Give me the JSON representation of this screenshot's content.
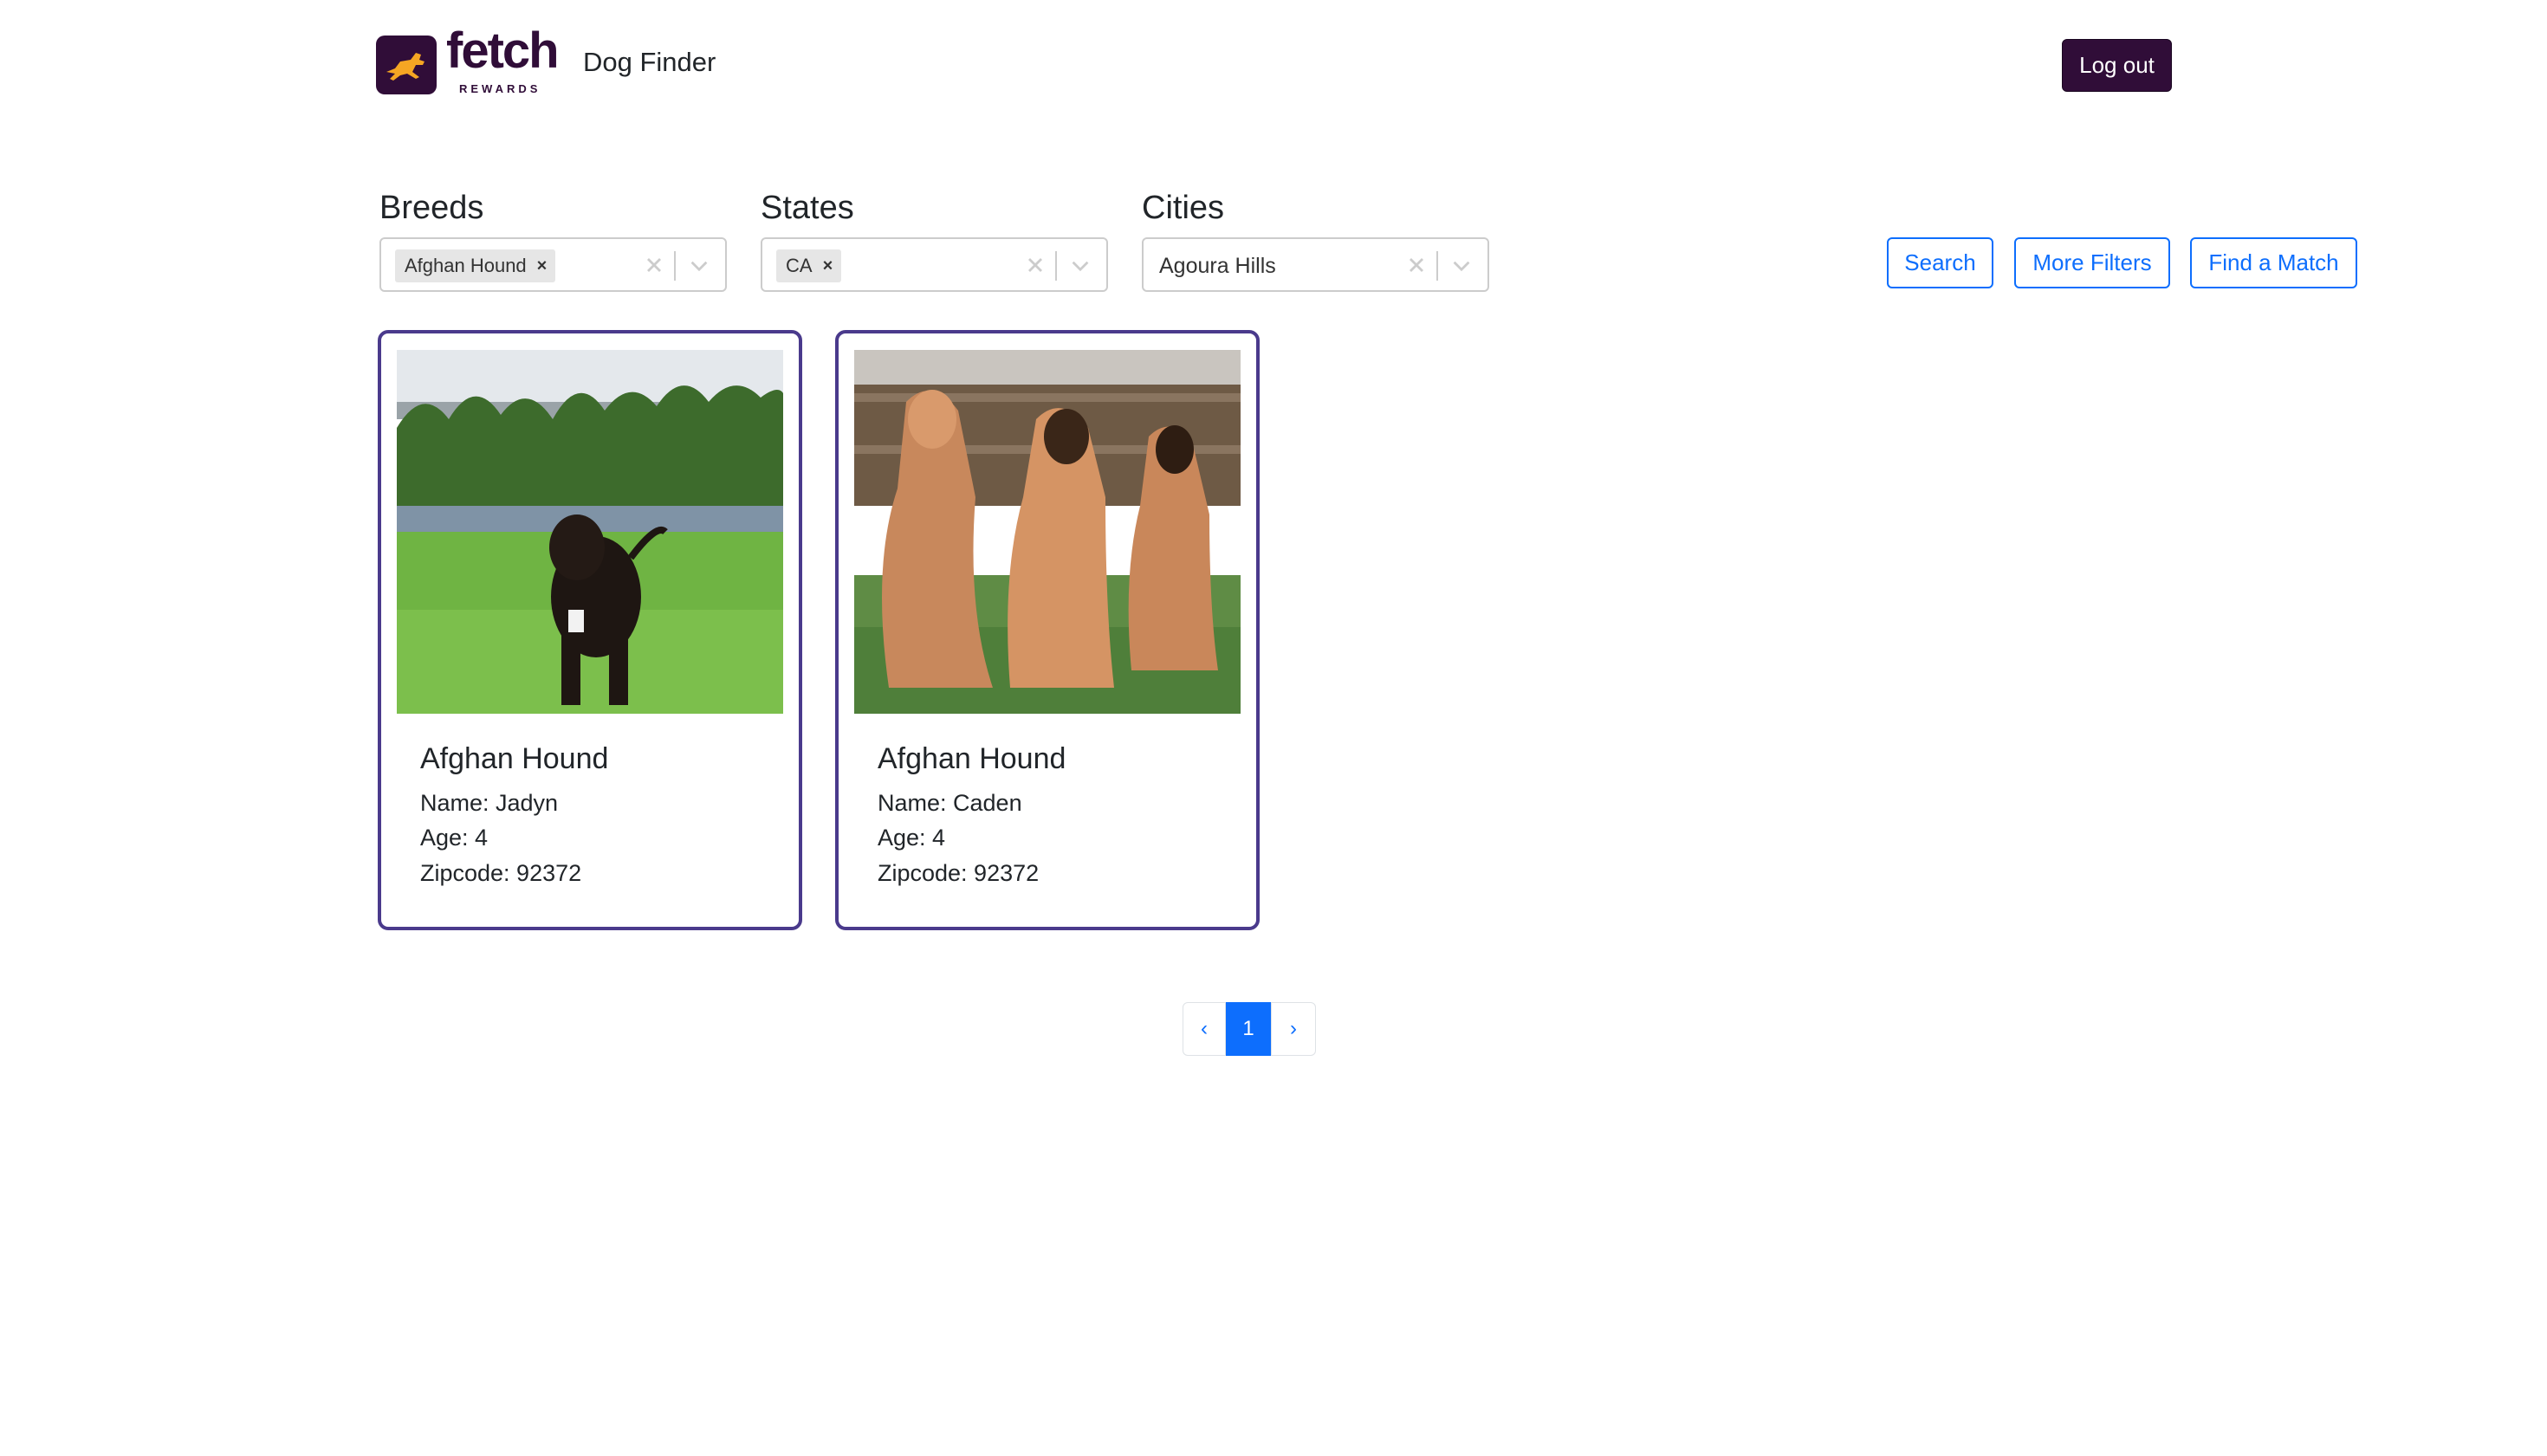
{
  "header": {
    "logo_word": "fetch",
    "logo_sub": "REWARDS",
    "app_title": "Dog Finder",
    "logout_label": "Log out"
  },
  "filters": {
    "breeds": {
      "label": "Breeds",
      "selected_chips": [
        "Afghan Hound"
      ]
    },
    "states": {
      "label": "States",
      "selected_chips": [
        "CA"
      ]
    },
    "cities": {
      "label": "Cities",
      "value": "Agoura Hills"
    }
  },
  "actions": {
    "search_label": "Search",
    "more_filters_label": "More Filters",
    "find_match_label": "Find a Match"
  },
  "dogs": [
    {
      "breed": "Afghan Hound",
      "name": "Name: Jadyn",
      "age": "Age: 4",
      "zipcode": "Zipcode: 92372"
    },
    {
      "breed": "Afghan Hound",
      "name": "Name: Caden",
      "age": "Age: 4",
      "zipcode": "Zipcode: 92372"
    }
  ],
  "pagination": {
    "prev": "‹",
    "current": "1",
    "next": "›"
  },
  "colors": {
    "brand": "#300d38",
    "accent": "#0d6efd",
    "card_border": "#4a3a8c",
    "logo_dog": "#f5a623"
  },
  "icons": {
    "logo": "running-dog-icon",
    "chip_remove": "close-icon",
    "clear": "clear-x-icon",
    "dropdown": "chevron-down-icon",
    "prev": "chevron-left-icon",
    "next": "chevron-right-icon"
  }
}
